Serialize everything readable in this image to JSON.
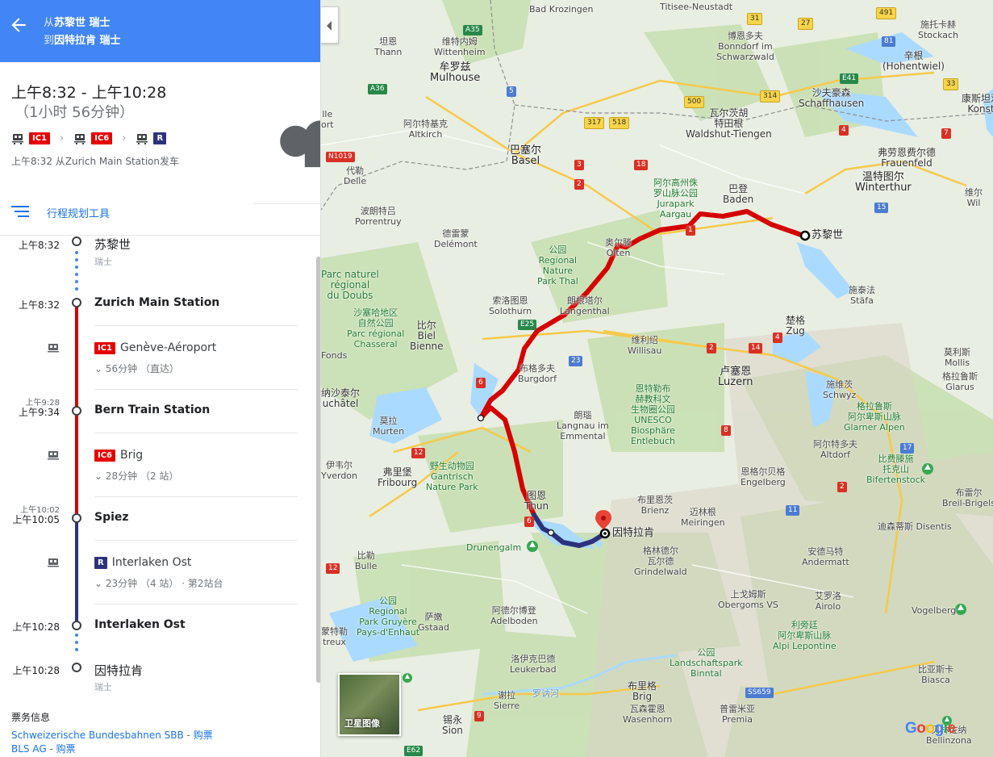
{
  "header": {
    "from_prefix": "从",
    "from_place": "苏黎世 瑞士",
    "to_prefix": "到",
    "to_place": "因特拉肯 瑞士"
  },
  "summary": {
    "time_range": "上午8:32 - 上午10:28",
    "duration": "（1小时 56分钟）",
    "chips": [
      {
        "label": "IC1",
        "color": "#e60000"
      },
      {
        "label": "IC6",
        "color": "#e60000"
      },
      {
        "label": "R",
        "color": "#2d327d"
      }
    ],
    "depart_note": "上午8:32 从Zurich Main Station发车"
  },
  "planner_label": "行程规划工具",
  "timeline": {
    "stops": [
      {
        "time": "上午8:32",
        "name": "苏黎世",
        "sub": "瑞士"
      },
      {
        "time": "上午8:32",
        "name": "Zurich Main Station"
      },
      {
        "time_small": "上午9:28",
        "time": "上午9:34",
        "name": "Bern Train Station"
      },
      {
        "time_small": "上午10:02",
        "time": "上午10:05",
        "name": "Spiez"
      },
      {
        "time": "上午10:28",
        "name": "Interlaken Ost"
      },
      {
        "time": "上午10:28",
        "name": "因特拉肯",
        "sub": "瑞士"
      }
    ],
    "legs": [
      {
        "badge": "IC1",
        "badge_color": "#e60000",
        "dest": "Genève-Aéroport",
        "meta": "56分钟 （直达）",
        "line_color": "#d50000"
      },
      {
        "badge": "IC6",
        "badge_color": "#e60000",
        "dest": "Brig",
        "meta": "28分钟 （2 站）",
        "line_color": "#d50000"
      },
      {
        "badge": "R",
        "badge_color": "#2d327d",
        "dest": "Interlaken Ost",
        "meta": "23分钟 （4 站）",
        "platform": "· 第2站台",
        "line_color": "#2d327d"
      }
    ]
  },
  "tickets": {
    "heading": "票务信息",
    "rows": [
      {
        "agency": "Schweizerische Bundesbahnen SBB",
        "sep": " - ",
        "action": "购票"
      },
      {
        "agency": "BLS AG",
        "sep": " - ",
        "action": "购票"
      }
    ]
  },
  "map": {
    "origin_label": "苏黎世",
    "destination_label": "因特拉肯",
    "satellite_label": "卫星图像",
    "google": "Google",
    "route_colors": {
      "rail": "#d50000",
      "regional": "#2d327d"
    },
    "places": [
      {
        "text": "Titisee-Neustadt"
      },
      {
        "text": "Bad Krozingen"
      },
      {
        "text": "维特内姆\nWittenheim"
      },
      {
        "text": "牟罗兹\nMulhouse"
      },
      {
        "text": "坦恩\nThann"
      },
      {
        "text": "博恩多夫\nBonndorf im\nSchwarzwald"
      },
      {
        "text": "辛根\n(Hohentwiel)"
      },
      {
        "text": "施托卡赫\nStockach"
      },
      {
        "text": "沙夫豪森\nSchaffhausen"
      },
      {
        "text": "康斯坦茨\nKonst"
      },
      {
        "text": "阿尔特基克\nAltkirch"
      },
      {
        "text": "巴塞尔\nBasel"
      },
      {
        "text": "瓦尔茨胡\n特田根\nWaldshut-Tiengen"
      },
      {
        "text": "弗劳恩费尔德\nFrauenfeld"
      },
      {
        "text": "温特图尔\nWinterthur"
      },
      {
        "text": "维尔\nWil"
      },
      {
        "text": "代勒\nDelle"
      },
      {
        "text": "波朗特吕\nPorrentruy"
      },
      {
        "text": "德雷蒙\nDelémont"
      },
      {
        "text": "巴登\nBaden"
      },
      {
        "text": "阿尔高州侏\n罗山脉公园\nJurapark\nAargau"
      },
      {
        "text": "公园\nRegional\nNature\nPark Thal"
      },
      {
        "text": "奥尔滕\nOlten"
      },
      {
        "text": "施泰法\nStäfa"
      },
      {
        "text": "Parc naturel\nrégional\ndu Doubs"
      },
      {
        "text": "沙塞哈地区\n自然公园\nParc régional\nChasseral"
      },
      {
        "text": "索洛图恩\nSolothurn"
      },
      {
        "text": "朗根塔尔\nLangenthal"
      },
      {
        "text": "楚格\nZug"
      },
      {
        "text": "比尔\nBiel\nBienne"
      },
      {
        "text": "维利绍\nWillisau"
      },
      {
        "text": "莫利斯\nMollis"
      },
      {
        "text": "格拉鲁斯\nGlarus"
      },
      {
        "text": "布格多夫\nBurgdorf"
      },
      {
        "text": "卢塞恩\nLuzern"
      },
      {
        "text": "施维茨\nSchwyz"
      },
      {
        "text": "纳沙泰尔\nuchâtel"
      },
      {
        "text": "恩特勒布\n赫教科文\n生物圈公园\nUNESCO\nBiosphäre\nEntlebuch"
      },
      {
        "text": "格拉鲁斯\n阿尔卑斯山脉\nGlarner Alpen"
      },
      {
        "text": "莫拉\nMurten"
      },
      {
        "text": "朗瑙\nLangnau im\nEmmental"
      },
      {
        "text": "阿尔特多夫\nAltdorf"
      },
      {
        "text": "比费滕施\n托克山\nBifertenstock"
      },
      {
        "text": "弗里堡\nFribourg"
      },
      {
        "text": "野生动物园\nGantrisch\nNature Park"
      },
      {
        "text": "恩格尔贝格\nEngelberg"
      },
      {
        "text": "布雷尔\nBreil-Brigels"
      },
      {
        "text": "图恩\nThun"
      },
      {
        "text": "布里恩茨\nBrienz"
      },
      {
        "text": "迈林根\nMeiringen"
      },
      {
        "text": "迪森蒂斯\nDisentis"
      },
      {
        "text": "Drunengalm"
      },
      {
        "text": "格林德尔\n瓦尔德\nGrindelwald"
      },
      {
        "text": "安德马特\nAndermatt"
      },
      {
        "text": "比勒\nBulle"
      },
      {
        "text": "上戈姆斯\nObergoms VS"
      },
      {
        "text": "艾罗洛\nAirolo"
      },
      {
        "text": "公园\nRegional\nPark Gruyère\nPays-d'Enhaut"
      },
      {
        "text": "萨嫩\nGstaad"
      },
      {
        "text": "阿德尔博登\nAdelboden"
      },
      {
        "text": "Vogelberg"
      },
      {
        "text": "利旁廷\n阿尔卑斯山脉\nAlpi Lepontine"
      },
      {
        "text": "洛伊克巴德\nLeukerbad"
      },
      {
        "text": "公园\nLandschaftspark\nBinntal"
      },
      {
        "text": "比亚斯卡\nBiasca"
      },
      {
        "text": "谢拉\nSierre"
      },
      {
        "text": "罗讷河"
      },
      {
        "text": "布里格\nBrig"
      },
      {
        "text": "瓦森霍恩\nWasenhorn"
      },
      {
        "text": "普雷米亚\nPremia"
      },
      {
        "text": "锡永\nSion"
      },
      {
        "text": "贝林佐纳\nBellinzona"
      },
      {
        "text": "蒙特勒\ntreux"
      },
      {
        "text": "伊韦尔\nYverdon"
      },
      {
        "text": "lle\nort"
      },
      {
        "text": "Fonds"
      }
    ],
    "roads": [
      {
        "label": "A35",
        "kind": "green"
      },
      {
        "label": "A36",
        "kind": "green"
      },
      {
        "label": "5",
        "kind": "blue"
      },
      {
        "label": "N1019",
        "kind": "red"
      },
      {
        "label": "317",
        "kind": "yellow"
      },
      {
        "label": "518",
        "kind": "yellow"
      },
      {
        "label": "3",
        "kind": "red"
      },
      {
        "label": "2",
        "kind": "red"
      },
      {
        "label": "18",
        "kind": "red"
      },
      {
        "label": "500",
        "kind": "yellow"
      },
      {
        "label": "314",
        "kind": "yellow"
      },
      {
        "label": "31",
        "kind": "yellow"
      },
      {
        "label": "27",
        "kind": "yellow"
      },
      {
        "label": "491",
        "kind": "yellow"
      },
      {
        "label": "81",
        "kind": "blue"
      },
      {
        "label": "E41",
        "kind": "green"
      },
      {
        "label": "33",
        "kind": "yellow"
      },
      {
        "label": "4",
        "kind": "red"
      },
      {
        "label": "7",
        "kind": "red"
      },
      {
        "label": "1",
        "kind": "red"
      },
      {
        "label": "15",
        "kind": "blue"
      },
      {
        "label": "E25",
        "kind": "green"
      },
      {
        "label": "23",
        "kind": "blue"
      },
      {
        "label": "2",
        "kind": "red"
      },
      {
        "label": "14",
        "kind": "red"
      },
      {
        "label": "4",
        "kind": "red"
      },
      {
        "label": "6",
        "kind": "red"
      },
      {
        "label": "8",
        "kind": "red"
      },
      {
        "label": "12",
        "kind": "red"
      },
      {
        "label": "17",
        "kind": "blue"
      },
      {
        "label": "11",
        "kind": "blue"
      },
      {
        "label": "2",
        "kind": "red"
      },
      {
        "label": "12",
        "kind": "red"
      },
      {
        "label": "6",
        "kind": "red"
      },
      {
        "label": "SS659",
        "kind": "blue"
      },
      {
        "label": "9",
        "kind": "red"
      },
      {
        "label": "E62",
        "kind": "green"
      }
    ]
  }
}
